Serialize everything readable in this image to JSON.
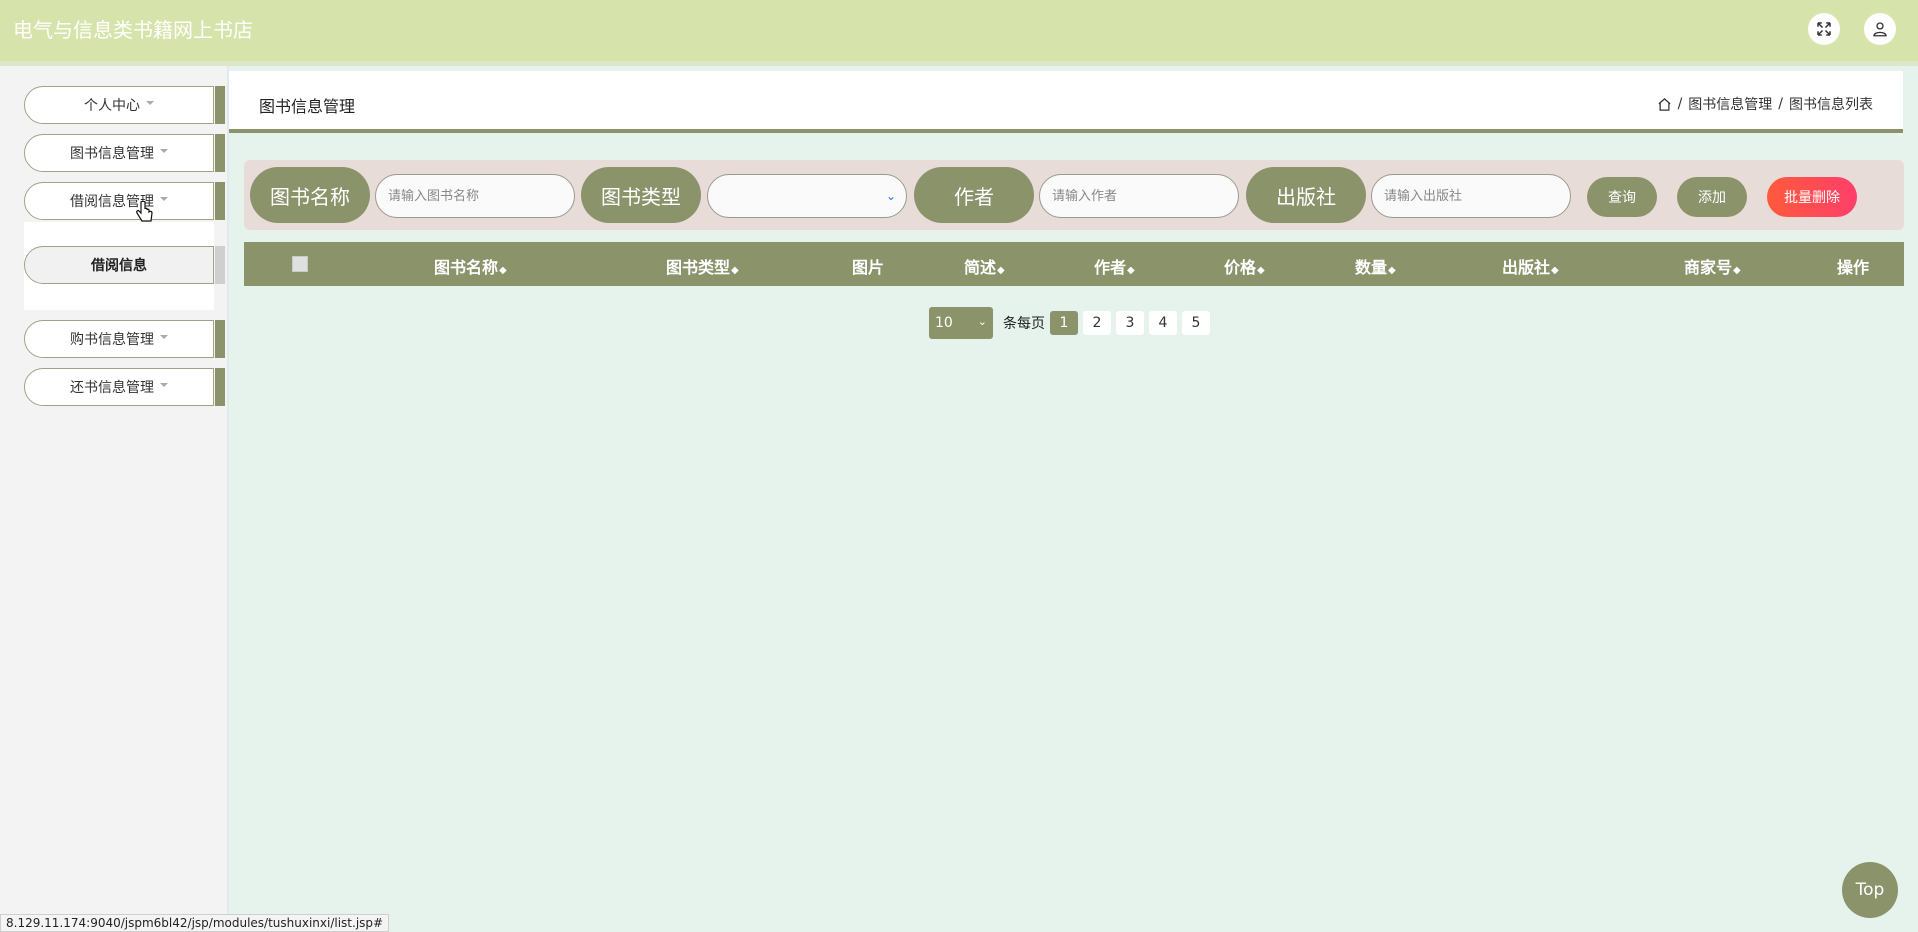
{
  "header": {
    "title": "电气与信息类书籍网上书店",
    "icons": [
      "fullscreen-icon",
      "user-icon"
    ]
  },
  "sidebar": {
    "items": [
      {
        "label": "个人中心"
      },
      {
        "label": "图书信息管理"
      },
      {
        "label": "借阅信息管理"
      },
      {
        "label": "购书信息管理"
      },
      {
        "label": "还书信息管理"
      }
    ],
    "subitem": {
      "label": "借阅信息"
    }
  },
  "breadcrumb": {
    "title": "图书信息管理",
    "path": [
      "图书信息管理",
      "图书信息列表"
    ],
    "separator": "/"
  },
  "search": {
    "name_label": "图书名称",
    "name_placeholder": "请输入图书名称",
    "type_label": "图书类型",
    "type_value": "",
    "author_label": "作者",
    "author_placeholder": "请输入作者",
    "publisher_label": "出版社",
    "publisher_placeholder": "请输入出版社",
    "query_button": "查询",
    "add_button": "添加",
    "batch_delete_button": "批量删除"
  },
  "table": {
    "columns": [
      "图书名称",
      "图书类型",
      "图片",
      "简述",
      "作者",
      "价格",
      "数量",
      "出版社",
      "商家号",
      "操作"
    ],
    "sortable": [
      true,
      true,
      false,
      true,
      true,
      true,
      true,
      true,
      true,
      false
    ],
    "rows": []
  },
  "pagination": {
    "page_size": "10",
    "per_page_label": "条每页",
    "pages": [
      "1",
      "2",
      "3",
      "4",
      "5"
    ],
    "current": "1"
  },
  "top_button": "Top",
  "status_url": "8.129.11.174:9040/jspm6bl42/jsp/modules/tushuxinxi/list.jsp#",
  "colors": {
    "header_bg": "#d6e3ab",
    "accent": "#8b936b",
    "danger": "#ff4a4a",
    "content_bg": "#e6f2ec"
  }
}
